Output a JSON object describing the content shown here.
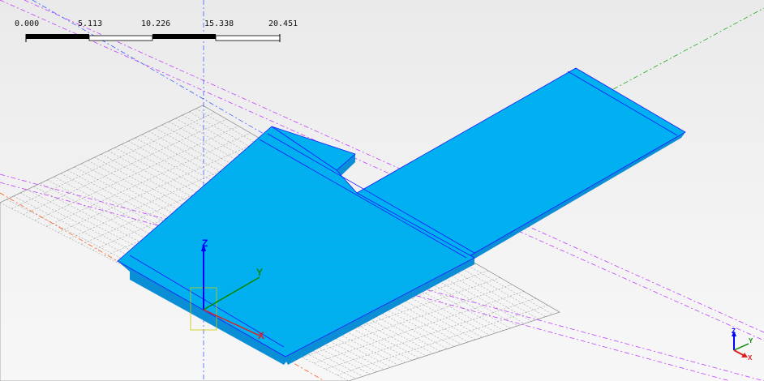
{
  "scale_bar": {
    "labels": [
      "0.000",
      "5.113",
      "10.226",
      "15.338",
      "20.451"
    ]
  },
  "axes": {
    "z_label": "Z",
    "y_label": "Y",
    "x_label": "X"
  },
  "triad": {
    "z_label": "Z",
    "y_label": "Y",
    "x_label": "X"
  },
  "colors": {
    "model_top": "#00b0f0",
    "model_side": "#0a8ed6",
    "model_edge": "#1a1aff",
    "grid": "#6e6e6e",
    "x_axis": "#e02020",
    "y_axis": "#00a000",
    "z_axis": "#0000ff",
    "guide_magenta": "#c040ff",
    "guide_blue": "#4060ff",
    "guide_orange": "#ff6020",
    "guide_green": "#22aa22"
  }
}
